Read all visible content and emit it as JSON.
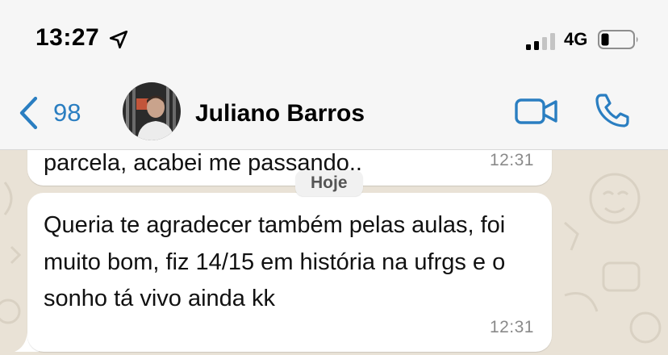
{
  "status_bar": {
    "time": "13:27",
    "network": "4G",
    "location_icon": "location-arrow-icon",
    "signal_icon": "signal-bars-icon",
    "battery_icon": "battery-low-icon"
  },
  "nav_bar": {
    "back_icon": "chevron-left-icon",
    "back_count": "98",
    "contact_name": "Juliano Barros",
    "video_icon": "video-camera-icon",
    "call_icon": "phone-icon"
  },
  "chat": {
    "date_separator": "Hoje",
    "messages": [
      {
        "text": "parcela, acabei me passando..",
        "time": "12:31"
      },
      {
        "text": "Queria te agradecer também pelas aulas, foi muito bom, fiz 14/15 em história na ufrgs e o sonho tá vivo ainda kk",
        "time": "12:31"
      }
    ]
  },
  "colors": {
    "accent": "#2a7ec1",
    "chat_background": "#e9e2d6",
    "bubble": "#ffffff",
    "header": "#f6f6f6"
  }
}
